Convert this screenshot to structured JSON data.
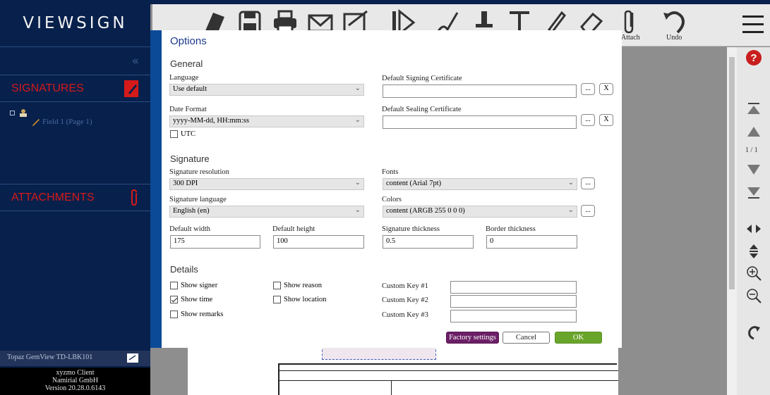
{
  "app": {
    "logo": "VIEWSIGN"
  },
  "sidebar": {
    "signatures_label": "SIGNATURES",
    "tree_field": "Field 1 (Page 1)",
    "attachments_label": "ATTACHMENTS",
    "device": "Topaz GemView TD-LBK101",
    "client_line1": "xyzmo Client",
    "client_line2": "Namirial GmbH",
    "client_line3": "Version 20.28.0.6143"
  },
  "toolbar": {
    "attach_label": "Attach",
    "undo_label": "Undo"
  },
  "right_panel": {
    "page_indicator": "1 / 1"
  },
  "dialog": {
    "title": "Options",
    "general": {
      "title": "General",
      "language_label": "Language",
      "language_value": "Use default",
      "date_format_label": "Date Format",
      "date_format_value": "yyyy-MM-dd, HH:mm:ss",
      "utc_label": "UTC",
      "signing_cert_label": "Default Signing Certificate",
      "signing_cert_value": "",
      "sealing_cert_label": "Default Sealing Certificate",
      "sealing_cert_value": "",
      "browse_label": "...",
      "clear_label": "X"
    },
    "signature": {
      "title": "Signature",
      "resolution_label": "Signature resolution",
      "resolution_value": "300 DPI",
      "language_label": "Signature language",
      "language_value": "English (en)",
      "fonts_label": "Fonts",
      "fonts_value": "content (Arial 7pt)",
      "colors_label": "Colors",
      "colors_value": "content (ARGB 255 0 0 0)",
      "default_width_label": "Default width",
      "default_width_value": "175",
      "default_height_label": "Default height",
      "default_height_value": "100",
      "thickness_label": "Signature thickness",
      "thickness_value": "0.5",
      "border_label": "Border thickness",
      "border_value": "0",
      "browse_label": "..."
    },
    "details": {
      "title": "Details",
      "show_signer": "Show signer",
      "show_reason": "Show reason",
      "show_time": "Show time",
      "show_location": "Show location",
      "show_remarks": "Show remarks",
      "show_time_checked": true,
      "custom_key_1_label": "Custom Key #1",
      "custom_key_2_label": "Custom Key #2",
      "custom_key_3_label": "Custom Key #3",
      "custom_key_1_value": "",
      "custom_key_2_value": "",
      "custom_key_3_value": ""
    },
    "buttons": {
      "factory": "Factory settings",
      "cancel": "Cancel",
      "ok": "OK"
    }
  },
  "colors": {
    "sidebar_bg": "#07204c",
    "accent_red": "#d51a1a",
    "dialog_accent": "#0b4a97",
    "factory_btn": "#6b1f66",
    "ok_btn": "#6aa52b"
  }
}
